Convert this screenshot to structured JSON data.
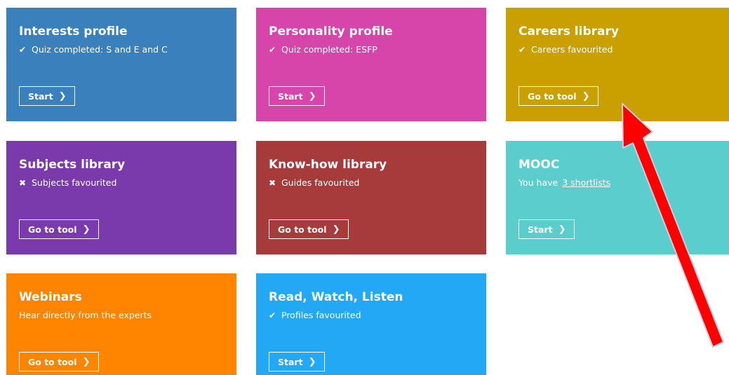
{
  "tiles": [
    {
      "title": "Interests profile",
      "status_icon": "✔",
      "status_text": "Quiz completed: S and E and C",
      "button": "Start",
      "color": "#3a80bd"
    },
    {
      "title": "Personality profile",
      "status_icon": "✔",
      "status_text": "Quiz completed: ESFP",
      "button": "Start",
      "color": "#d745ab"
    },
    {
      "title": "Careers library",
      "status_icon": "✔",
      "status_text": "Careers favourited",
      "button": "Go to tool",
      "color": "#c9a000"
    },
    {
      "title": "Subjects library",
      "status_icon": "✖",
      "status_text": "Subjects favourited",
      "button": "Go to tool",
      "color": "#7b3aab"
    },
    {
      "title": "Know-how library",
      "status_icon": "✖",
      "status_text": "Guides favourited",
      "button": "Go to tool",
      "color": "#a73a3a"
    },
    {
      "title": "MOOC",
      "status_prefix": "You have",
      "status_link": "3 shortlists",
      "button": "Start",
      "color": "#5ccdcd"
    },
    {
      "title": "Webinars",
      "status_text": "Hear directly from the experts",
      "button": "Go to tool",
      "color": "#ff8500"
    },
    {
      "title": "Read, Watch, Listen",
      "status_icon": "✔",
      "status_text": "Profiles favourited",
      "button": "Start",
      "color": "#23a8f5"
    }
  ],
  "chevron": "❯",
  "annotation_arrow_color": "#ff0000"
}
